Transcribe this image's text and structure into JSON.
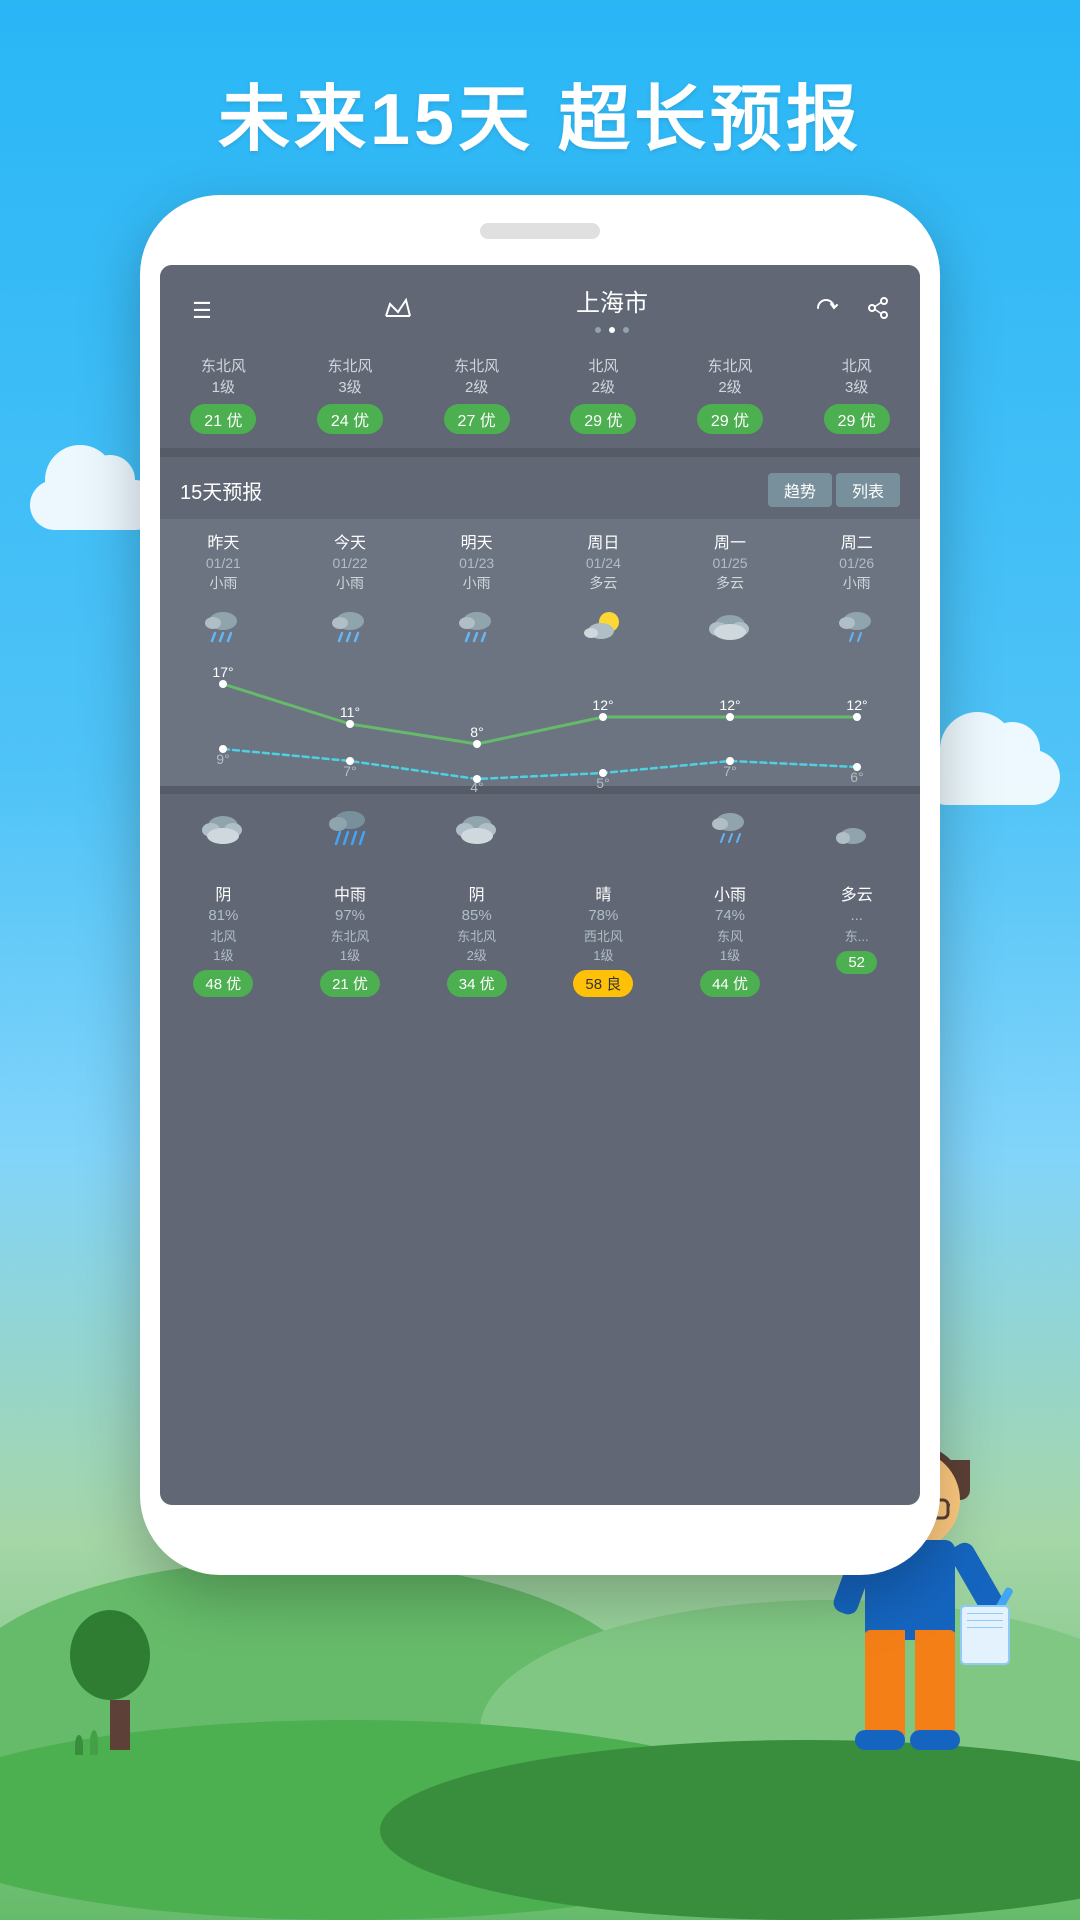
{
  "page": {
    "title": "未来15天  超长预报",
    "bg_top": "#29b6f6",
    "bg_bottom": "#4caf50"
  },
  "header": {
    "menu_icon": "☰",
    "crown_icon": "♛",
    "city": "上海市",
    "dots": [
      false,
      true,
      false
    ],
    "refresh_icon": "↻",
    "share_icon": "↗"
  },
  "top_aq_row": [
    {
      "wind": "东北风\n1级",
      "badge": "21 优",
      "yellow": false
    },
    {
      "wind": "东北风\n3级",
      "badge": "24 优",
      "yellow": false
    },
    {
      "wind": "东北风\n2级",
      "badge": "27 优",
      "yellow": false
    },
    {
      "wind": "北风\n2级",
      "badge": "29 优",
      "yellow": false
    },
    {
      "wind": "东北风\n2级",
      "badge": "29 优",
      "yellow": false
    },
    {
      "wind": "北风\n3级",
      "badge": "29 优",
      "yellow": false
    }
  ],
  "forecast_section": {
    "title": "15天预报",
    "tab1": "趋势",
    "tab2": "列表"
  },
  "days": [
    {
      "name": "昨天",
      "date": "01/21",
      "weather": "小雨",
      "icon": "rain"
    },
    {
      "name": "今天",
      "date": "01/22",
      "weather": "小雨",
      "icon": "rain"
    },
    {
      "name": "明天",
      "date": "01/23",
      "weather": "小雨",
      "icon": "rain"
    },
    {
      "name": "周日",
      "date": "01/24",
      "weather": "多云",
      "icon": "partly_cloudy"
    },
    {
      "name": "周一",
      "date": "01/25",
      "weather": "多云",
      "icon": "cloudy"
    },
    {
      "name": "周二",
      "date": "01/26",
      "weather": "小雨",
      "icon": "light_rain"
    }
  ],
  "temps_high": [
    17,
    11,
    8,
    12,
    12,
    12
  ],
  "temps_low": [
    9,
    7,
    4,
    5,
    7,
    6
  ],
  "bottom_weather": [
    {
      "type": "阴",
      "percent": "81%",
      "wind": "北风\n1级",
      "badge": "48 优",
      "yellow": false
    },
    {
      "type": "中雨",
      "percent": "97%",
      "wind": "东北风\n1级",
      "badge": "21 优",
      "yellow": false
    },
    {
      "type": "阴",
      "percent": "85%",
      "wind": "东北风\n2级",
      "badge": "34 优",
      "yellow": false
    },
    {
      "type": "晴",
      "percent": "78%",
      "wind": "西北风\n1级",
      "badge": "58 良",
      "yellow": true
    },
    {
      "type": "小雨",
      "percent": "74%",
      "wind": "东风\n1级",
      "badge": "44 优",
      "yellow": false
    },
    {
      "type": "多云",
      "percent": "...",
      "wind": "东...",
      "badge": "52",
      "yellow": false
    }
  ]
}
